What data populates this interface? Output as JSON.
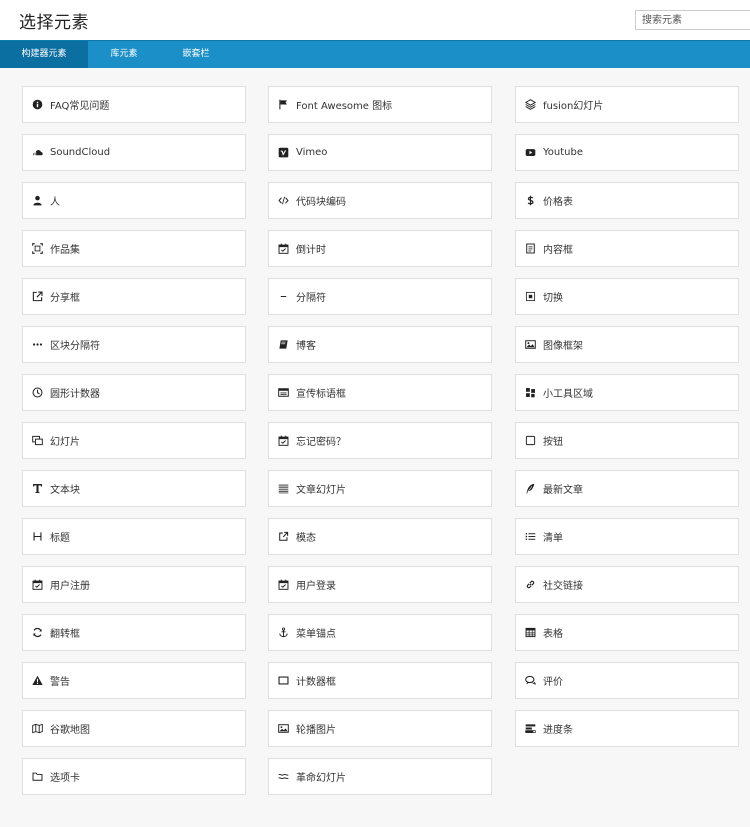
{
  "header": {
    "title": "选择元素",
    "search_placeholder": "搜索元素"
  },
  "tabs": [
    {
      "label": "构建器元素",
      "active": true
    },
    {
      "label": "库元素",
      "active": false
    },
    {
      "label": "嵌套栏",
      "active": false
    }
  ],
  "colors": {
    "tab_bar": "#1a8fc8",
    "tab_active": "#0c6fa1",
    "card_border": "#dfdfdf",
    "background": "#f7f7f7"
  },
  "elements": [
    {
      "label": "FAQ常见问题",
      "icon": "info-circle-icon"
    },
    {
      "label": "Font Awesome 图标",
      "icon": "flag-icon"
    },
    {
      "label": "fusion幻灯片",
      "icon": "layers-icon"
    },
    {
      "label": "SoundCloud",
      "icon": "soundcloud-icon"
    },
    {
      "label": "Vimeo",
      "icon": "vimeo-icon"
    },
    {
      "label": "Youtube",
      "icon": "youtube-icon"
    },
    {
      "label": "人",
      "icon": "person-icon"
    },
    {
      "label": "代码块编码",
      "icon": "code-icon"
    },
    {
      "label": "价格表",
      "icon": "dollar-icon"
    },
    {
      "label": "作品集",
      "icon": "portfolio-frame-icon"
    },
    {
      "label": "倒计时",
      "icon": "calendar-check-icon"
    },
    {
      "label": "内容框",
      "icon": "document-icon"
    },
    {
      "label": "分享框",
      "icon": "share-box-icon"
    },
    {
      "label": "分隔符",
      "icon": "minus-icon"
    },
    {
      "label": "切换",
      "icon": "toggle-box-icon"
    },
    {
      "label": "区块分隔符",
      "icon": "ellipsis-icon"
    },
    {
      "label": "博客",
      "icon": "book-icon"
    },
    {
      "label": "图像框架",
      "icon": "image-icon"
    },
    {
      "label": "圆形计数器",
      "icon": "clock-icon"
    },
    {
      "label": "宣传标语框",
      "icon": "banner-icon"
    },
    {
      "label": "小工具区域",
      "icon": "widget-grid-icon"
    },
    {
      "label": "幻灯片",
      "icon": "slides-icon"
    },
    {
      "label": "忘记密码？",
      "icon": "calendar-check-icon"
    },
    {
      "label": "按钮",
      "icon": "button-square-icon"
    },
    {
      "label": "文本块",
      "icon": "text-t-icon"
    },
    {
      "label": "文章幻灯片",
      "icon": "stacked-lines-icon"
    },
    {
      "label": "最新文章",
      "icon": "feather-icon"
    },
    {
      "label": "标题",
      "icon": "heading-h-icon"
    },
    {
      "label": "模态",
      "icon": "external-link-icon"
    },
    {
      "label": "清单",
      "icon": "list-icon"
    },
    {
      "label": "用户注册",
      "icon": "calendar-check-icon"
    },
    {
      "label": "用户登录",
      "icon": "calendar-check-icon"
    },
    {
      "label": "社交链接",
      "icon": "link-icon"
    },
    {
      "label": "翻转框",
      "icon": "refresh-icon"
    },
    {
      "label": "菜单锚点",
      "icon": "anchor-icon"
    },
    {
      "label": "表格",
      "icon": "table-icon"
    },
    {
      "label": "警告",
      "icon": "warning-icon"
    },
    {
      "label": "计数器框",
      "icon": "rectangle-icon"
    },
    {
      "label": "评价",
      "icon": "comments-icon"
    },
    {
      "label": "谷歌地图",
      "icon": "map-icon"
    },
    {
      "label": "轮播图片",
      "icon": "image-carousel-icon"
    },
    {
      "label": "进度条",
      "icon": "progress-bars-icon"
    },
    {
      "label": "选项卡",
      "icon": "folder-icon"
    },
    {
      "label": "革命幻灯片",
      "icon": "wave-icon"
    }
  ]
}
